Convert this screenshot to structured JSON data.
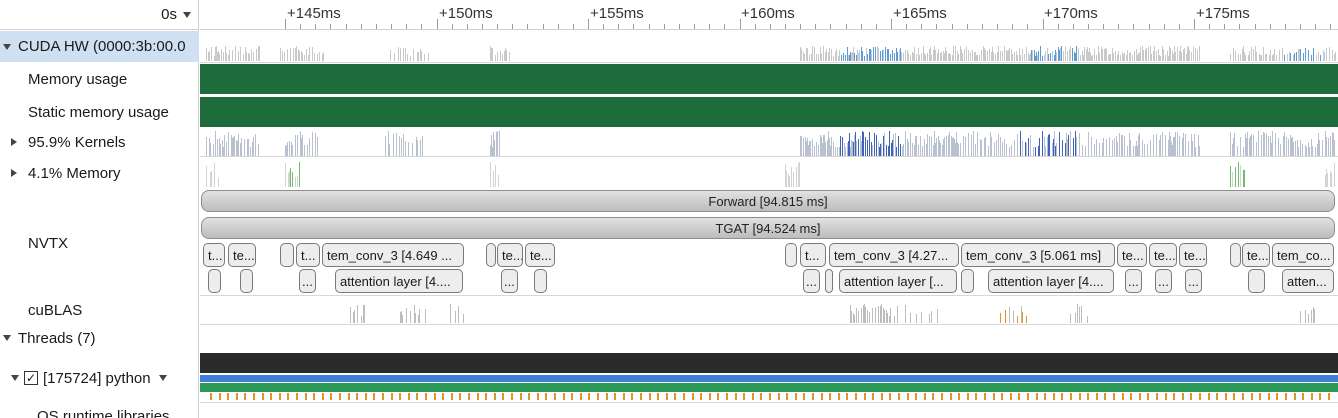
{
  "toolbar": {
    "time_origin": "0s"
  },
  "ruler": {
    "labels": [
      "+145ms",
      "+150ms",
      "+155ms",
      "+160ms",
      "+165ms",
      "+170ms",
      "+175ms"
    ]
  },
  "tree": {
    "cuda_hw": "CUDA HW (0000:3b:00.0",
    "memory_usage": "Memory usage",
    "static_memory_usage": "Static memory usage",
    "kernels": "95.9% Kernels",
    "memory": "4.1% Memory",
    "nvtx": "NVTX",
    "cublas": "cuBLAS",
    "threads": "Threads (7)",
    "python_thread": "[175724] python",
    "python_thread_checked": "✓",
    "os_runtime": "OS runtime libraries"
  },
  "nvtx": {
    "forward": "Forward [94.815 ms]",
    "tgat": "TGAT [94.524 ms]",
    "row1": [
      "t...",
      "te...",
      "t...",
      "tem_conv_3 [4.649 ...",
      "te...",
      "te...",
      "t...",
      "tem_conv_3 [4.27...",
      "tem_conv_3 [5.061 ms]",
      "te...",
      "te...",
      "te...",
      "te...",
      "tem_co..."
    ],
    "row2": [
      "...",
      "attention layer [4....",
      "...",
      "...",
      "attention layer [...",
      "attention layer [4....",
      "...",
      "...",
      "...",
      "atten..."
    ]
  },
  "colors": {
    "memory_green": "#1e6b3c",
    "kernel_blue": "#3e63b8",
    "selection": "#cfe0f3",
    "thread_dark": "#2a2a2a",
    "thread_blue": "#3d7fd8",
    "thread_green": "#2e9a58",
    "thread_orange": "#e8902a"
  }
}
